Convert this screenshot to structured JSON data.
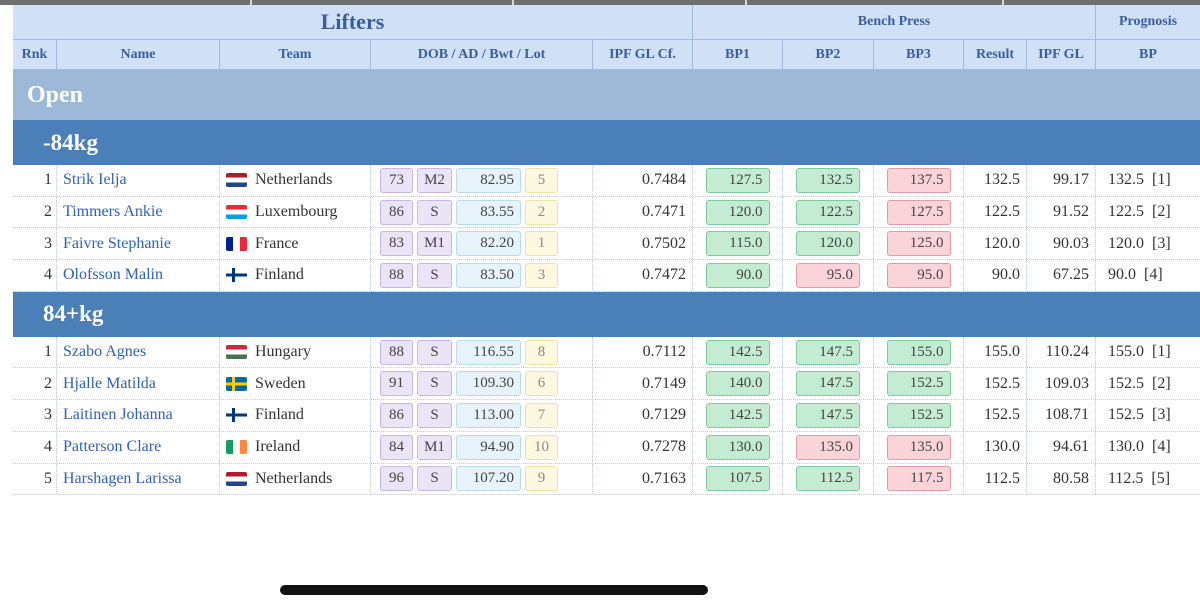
{
  "header": {
    "lifters": "Lifters",
    "bench_press": "Bench Press",
    "prognosis": "Prognosis"
  },
  "columns": {
    "rnk": "Rnk",
    "name": "Name",
    "team": "Team",
    "dob": "DOB / AD / Bwt / Lot",
    "ipf_gl_cf": "IPF GL Cf.",
    "bp1": "BP1",
    "bp2": "BP2",
    "bp3": "BP3",
    "result": "Result",
    "ipf_gl": "IPF GL",
    "bp": "BP"
  },
  "category": "Open",
  "classes": [
    {
      "label": "-84kg",
      "lifters": [
        {
          "rank": "1",
          "name": "Strik Ielja",
          "team": "Netherlands",
          "flag": "nl",
          "dob": "73",
          "ad": "M2",
          "bwt": "82.95",
          "lot": "5",
          "cf": "0.7484",
          "bp1": "127.5",
          "bp1_ok": true,
          "bp2": "132.5",
          "bp2_ok": true,
          "bp3": "137.5",
          "bp3_ok": false,
          "result": "132.5",
          "gl": "99.17",
          "prognosis": "132.5  [1]"
        },
        {
          "rank": "2",
          "name": "Timmers Ankie",
          "team": "Luxembourg",
          "flag": "lu",
          "dob": "86",
          "ad": "S",
          "bwt": "83.55",
          "lot": "2",
          "cf": "0.7471",
          "bp1": "120.0",
          "bp1_ok": true,
          "bp2": "122.5",
          "bp2_ok": true,
          "bp3": "127.5",
          "bp3_ok": false,
          "result": "122.5",
          "gl": "91.52",
          "prognosis": "122.5  [2]"
        },
        {
          "rank": "3",
          "name": "Faivre Stephanie",
          "team": "France",
          "flag": "fr",
          "dob": "83",
          "ad": "M1",
          "bwt": "82.20",
          "lot": "1",
          "cf": "0.7502",
          "bp1": "115.0",
          "bp1_ok": true,
          "bp2": "120.0",
          "bp2_ok": true,
          "bp3": "125.0",
          "bp3_ok": false,
          "result": "120.0",
          "gl": "90.03",
          "prognosis": "120.0  [3]"
        },
        {
          "rank": "4",
          "name": "Olofsson Malin",
          "team": "Finland",
          "flag": "fi",
          "dob": "88",
          "ad": "S",
          "bwt": "83.50",
          "lot": "3",
          "cf": "0.7472",
          "bp1": "90.0",
          "bp1_ok": true,
          "bp2": "95.0",
          "bp2_ok": false,
          "bp3": "95.0",
          "bp3_ok": false,
          "result": "90.0",
          "gl": "67.25",
          "prognosis": "90.0  [4]"
        }
      ]
    },
    {
      "label": "84+kg",
      "lifters": [
        {
          "rank": "1",
          "name": "Szabo Agnes",
          "team": "Hungary",
          "flag": "hu",
          "dob": "88",
          "ad": "S",
          "bwt": "116.55",
          "lot": "8",
          "cf": "0.7112",
          "bp1": "142.5",
          "bp1_ok": true,
          "bp2": "147.5",
          "bp2_ok": true,
          "bp3": "155.0",
          "bp3_ok": true,
          "result": "155.0",
          "gl": "110.24",
          "prognosis": "155.0  [1]"
        },
        {
          "rank": "2",
          "name": "Hjalle Matilda",
          "team": "Sweden",
          "flag": "se",
          "dob": "91",
          "ad": "S",
          "bwt": "109.30",
          "lot": "6",
          "cf": "0.7149",
          "bp1": "140.0",
          "bp1_ok": true,
          "bp2": "147.5",
          "bp2_ok": true,
          "bp3": "152.5",
          "bp3_ok": true,
          "result": "152.5",
          "gl": "109.03",
          "prognosis": "152.5  [2]"
        },
        {
          "rank": "3",
          "name": "Laitinen Johanna",
          "team": "Finland",
          "flag": "fi",
          "dob": "86",
          "ad": "S",
          "bwt": "113.00",
          "lot": "7",
          "cf": "0.7129",
          "bp1": "142.5",
          "bp1_ok": true,
          "bp2": "147.5",
          "bp2_ok": true,
          "bp3": "152.5",
          "bp3_ok": true,
          "result": "152.5",
          "gl": "108.71",
          "prognosis": "152.5  [3]"
        },
        {
          "rank": "4",
          "name": "Patterson Clare",
          "team": "Ireland",
          "flag": "ie",
          "dob": "84",
          "ad": "M1",
          "bwt": "94.90",
          "lot": "10",
          "cf": "0.7278",
          "bp1": "130.0",
          "bp1_ok": true,
          "bp2": "135.0",
          "bp2_ok": false,
          "bp3": "135.0",
          "bp3_ok": false,
          "result": "130.0",
          "gl": "94.61",
          "prognosis": "130.0  [4]"
        },
        {
          "rank": "5",
          "name": "Harshagen Larissa",
          "team": "Netherlands",
          "flag": "nl",
          "dob": "96",
          "ad": "S",
          "bwt": "107.20",
          "lot": "9",
          "cf": "0.7163",
          "bp1": "107.5",
          "bp1_ok": true,
          "bp2": "112.5",
          "bp2_ok": true,
          "bp3": "117.5",
          "bp3_ok": false,
          "result": "112.5",
          "gl": "80.58",
          "prognosis": "112.5  [5]"
        }
      ]
    }
  ],
  "colors": {
    "good_lift": "#c4ecd2",
    "no_lift": "#fbd4d9",
    "category_bar": "#9eb9d8",
    "weight_bar": "#4a7fb8",
    "header_bg": "#cfe0f7",
    "name_link": "#2f62b5"
  }
}
